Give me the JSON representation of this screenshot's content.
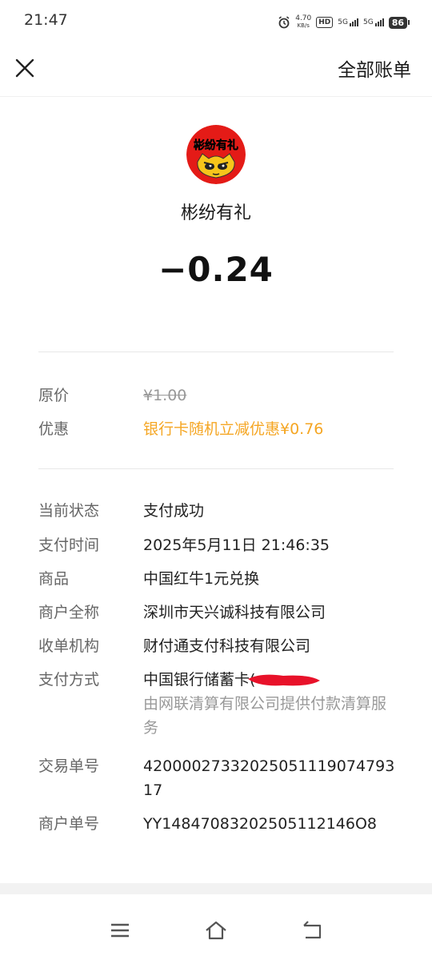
{
  "status_bar": {
    "time": "21:47",
    "net_speed_value": "4.70",
    "net_speed_unit": "KB/s",
    "hd_label": "HD",
    "signal1_label": "5G",
    "signal2_label": "5G",
    "battery": "86"
  },
  "header": {
    "close_icon": "close-icon",
    "all_bills_label": "全部账单"
  },
  "merchant": {
    "avatar_text": "彬纷有礼",
    "name": "彬纷有礼",
    "amount": "−0.24"
  },
  "price_section": [
    {
      "label": "原价",
      "value": "¥1.00"
    },
    {
      "label": "优惠",
      "value": "银行卡随机立减优惠¥0.76"
    }
  ],
  "details": {
    "status": {
      "label": "当前状态",
      "value": "支付成功"
    },
    "pay_time": {
      "label": "支付时间",
      "value": "2025年5月11日 21:46:35"
    },
    "product": {
      "label": "商品",
      "value": "中国红牛1元兑换"
    },
    "merchant_full": {
      "label": "商户全称",
      "value": "深圳市天兴诚科技有限公司"
    },
    "acquirer": {
      "label": "收单机构",
      "value": "财付通支付科技有限公司"
    },
    "pay_method": {
      "label": "支付方式",
      "value": "中国银行储蓄卡(",
      "note": "由网联清算有限公司提供付款清算服务"
    },
    "transaction_no": {
      "label": "交易单号",
      "value": "4200002733202505111907479317"
    },
    "merchant_no": {
      "label": "商户单号",
      "value": "YY14847083202505112146O8"
    }
  },
  "colors": {
    "discount": "#f5a623",
    "avatar_red": "#e41b17",
    "avatar_yellow": "#f7c51b"
  },
  "nav": {
    "menu_icon": "menu-icon",
    "home_icon": "home-icon",
    "back_icon": "back-icon"
  }
}
